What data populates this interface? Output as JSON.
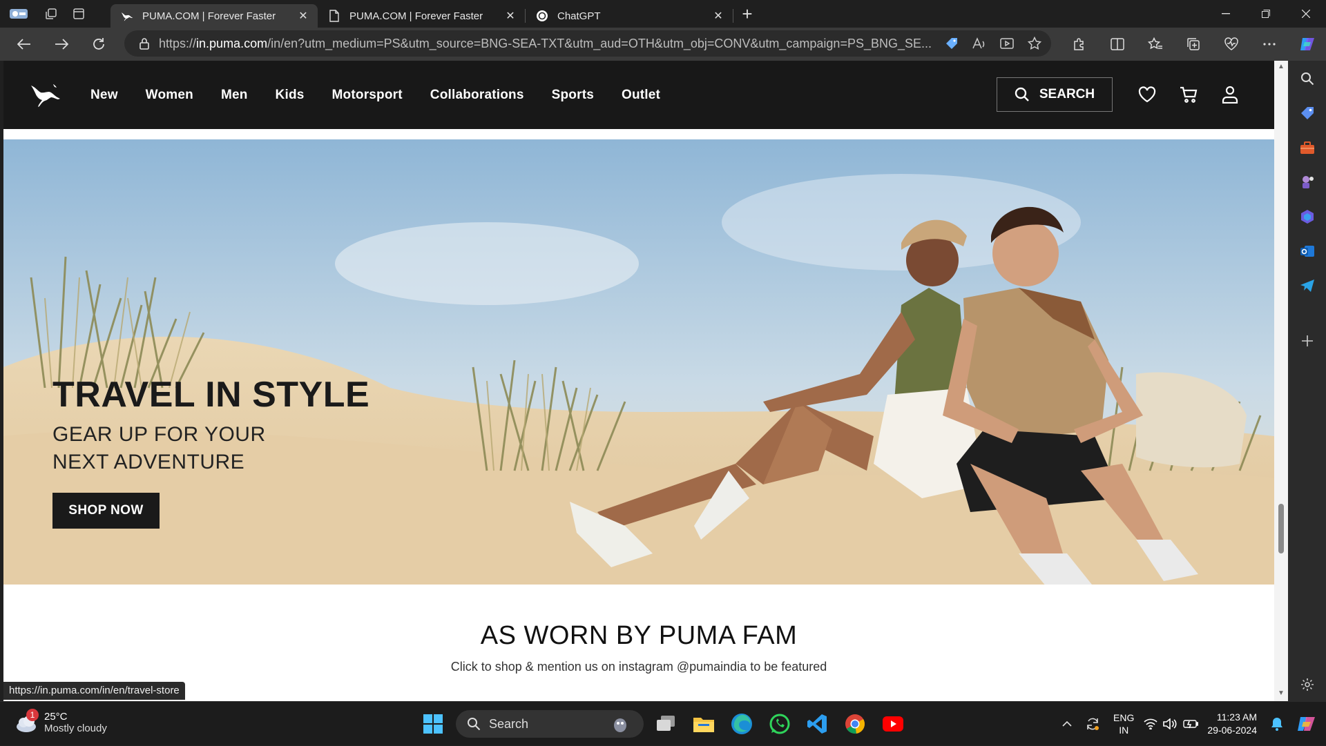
{
  "browser": {
    "tabs": [
      {
        "title": "PUMA.COM | Forever Faster",
        "active": true
      },
      {
        "title": "PUMA.COM | Forever Faster",
        "active": false
      },
      {
        "title": "ChatGPT",
        "active": false
      }
    ],
    "url_prefix": "https://",
    "url_host": "in.puma.com",
    "url_rest": "/in/en?utm_medium=PS&utm_source=BNG-SEA-TXT&utm_aud=OTH&utm_obj=CONV&utm_campaign=PS_BNG_SE...",
    "status_url": "https://in.puma.com/in/en/travel-store"
  },
  "site": {
    "menu": [
      "New",
      "Women",
      "Men",
      "Kids",
      "Motorsport",
      "Collaborations",
      "Sports",
      "Outlet"
    ],
    "search_label": "SEARCH",
    "hero": {
      "title": "TRAVEL IN STYLE",
      "subtitle_line1": "GEAR UP FOR YOUR",
      "subtitle_line2": "NEXT ADVENTURE",
      "cta": "SHOP NOW"
    },
    "fam": {
      "title": "AS WORN BY PUMA FAM",
      "subtitle": "Click to shop & mention us on instagram @pumaindia to be featured"
    }
  },
  "taskbar": {
    "weather_badge": "1",
    "temperature": "25°C",
    "condition": "Mostly cloudy",
    "search_label": "Search",
    "lang_line1": "ENG",
    "lang_line2": "IN",
    "time": "11:23 AM",
    "date": "29-06-2024"
  },
  "colors": {
    "puma_black": "#181818",
    "browser_dark": "#1f1f1f",
    "toolbar": "#3a3a3a"
  }
}
